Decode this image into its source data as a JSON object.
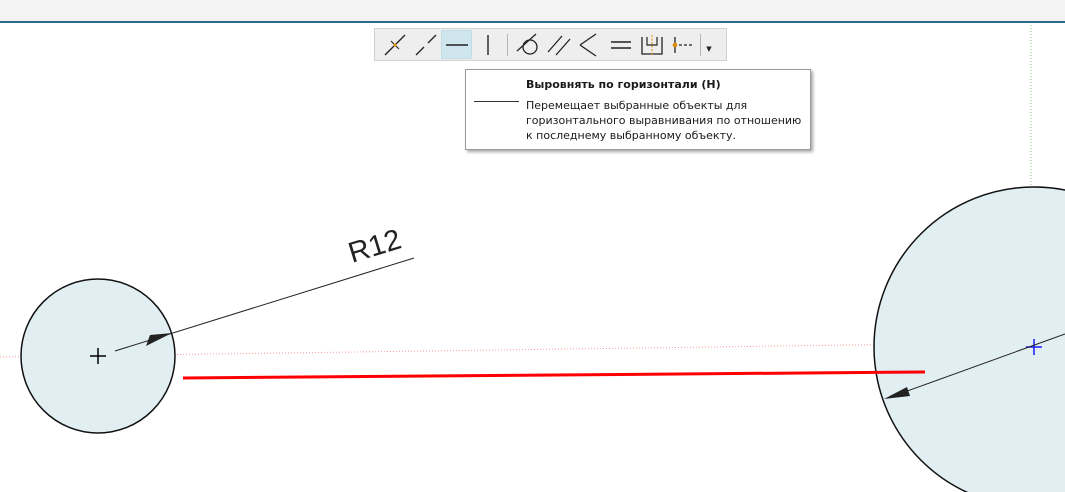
{
  "toolbar": {
    "buttons": [
      {
        "icon": "coincident-icon",
        "active": false
      },
      {
        "icon": "collinear-icon",
        "active": false
      },
      {
        "icon": "horizontal-icon",
        "active": true
      },
      {
        "icon": "vertical-icon",
        "active": false
      },
      {
        "icon": "tangent-icon",
        "active": false
      },
      {
        "icon": "parallel-icon",
        "active": false
      },
      {
        "icon": "perpendicular-icon",
        "active": false
      },
      {
        "icon": "equal-icon",
        "active": false
      },
      {
        "icon": "symmetric-icon",
        "active": false
      },
      {
        "icon": "fix-point-icon",
        "active": false
      }
    ],
    "more_icon": "dropdown-arrow-icon",
    "more_glyph": "▼"
  },
  "tooltip": {
    "title": "Выровнять по горизонтали (H)",
    "description": "Перемещает выбранные объекты для горизонтального выравнивания по отношению к последнему выбранному объекту."
  },
  "drawing": {
    "dimension_label": "R12",
    "colors": {
      "circle_fill": "#e1eef2",
      "selected_line": "#ff0000",
      "guide": "#ff9a9a",
      "center_mark_selected": "#1a1aff",
      "toolbar_active": "#cfe6ef",
      "frame_accent": "#2a6a8e"
    }
  }
}
